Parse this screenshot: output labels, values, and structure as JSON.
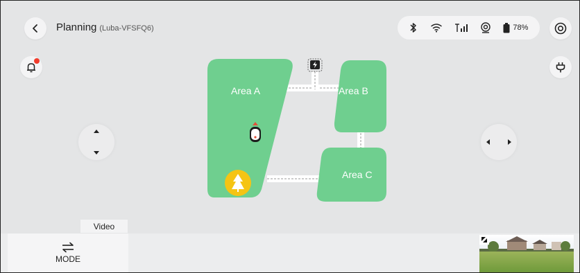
{
  "header": {
    "title": "Planning",
    "device": "(Luba-VFSFQ6)"
  },
  "status": {
    "battery": "78%"
  },
  "map": {
    "areas": [
      {
        "label": "Area A"
      },
      {
        "label": "Area B"
      },
      {
        "label": "Area C"
      }
    ]
  },
  "bottom": {
    "mode_label": "MODE",
    "video_label": "Video"
  },
  "colors": {
    "area": "#6fcf8f",
    "alert_dot": "#f23c2b",
    "tree_badge": "#f5c414"
  }
}
